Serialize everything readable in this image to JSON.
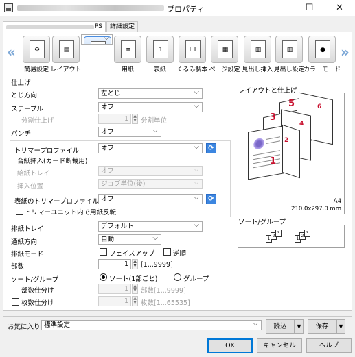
{
  "window": {
    "title": "プロパティ",
    "minimize": "—",
    "maximize": "☐",
    "close": "✕"
  },
  "tabs": [
    {
      "label": "PS"
    },
    {
      "label": "詳細設定"
    }
  ],
  "icon_bar": {
    "prev_arrow": "«",
    "next_arrow": "»",
    "items": [
      {
        "label": "簡易設定",
        "icon": "quick-setup-icon",
        "glyph": "⚙"
      },
      {
        "label": "レイアウト",
        "icon": "layout-icon",
        "glyph": "▤"
      },
      {
        "label": "仕上げ",
        "icon": "finishing-icon",
        "glyph": "☰",
        "selected": true
      },
      {
        "label": "用紙",
        "icon": "paper-icon",
        "glyph": "≡"
      },
      {
        "label": "表紙",
        "icon": "cover-icon",
        "glyph": "1"
      },
      {
        "label": "くるみ製本",
        "icon": "perfect-binding-icon",
        "glyph": "❐"
      },
      {
        "label": "ページ設定",
        "icon": "page-setting-icon",
        "glyph": "▦"
      },
      {
        "label": "見出し挿入",
        "icon": "tab-insert-icon",
        "glyph": "▥"
      },
      {
        "label": "見出し設定",
        "icon": "tab-setting-icon",
        "glyph": "▥"
      },
      {
        "label": "カラーモード",
        "icon": "color-mode-icon",
        "glyph": "●"
      }
    ]
  },
  "finishing": {
    "section_title": "仕上げ",
    "binding": {
      "label": "とじ方向",
      "value": "左とじ"
    },
    "staple": {
      "label": "ステープル",
      "value": "オフ"
    },
    "split": {
      "label": "分割仕上げ",
      "value": "1",
      "unit": "分割単位"
    },
    "punch": {
      "label": "パンチ",
      "value": "オフ"
    },
    "trimmer": {
      "label": "トリマープロファイル",
      "value": "オフ"
    },
    "interleave_title": "合紙挿入(カード断裁用)",
    "feed_tray": {
      "label": "給紙トレイ",
      "value": "オフ"
    },
    "insert_pos": {
      "label": "挿入位置",
      "value": "ジョブ単位(後)"
    },
    "cover_trimmer": {
      "label": "表紙のトリマープロファイル",
      "value": "オフ"
    },
    "reverse": {
      "label": "トリマーユニット内で用紙反転"
    },
    "output_tray": {
      "label": "排紙トレイ",
      "value": "デフォルト"
    },
    "feed_direction": {
      "label": "通紙方向",
      "value": "自動"
    },
    "output_mode": {
      "label": "排紙モード",
      "faceup": "フェイスアップ",
      "reverse_order": "逆順"
    },
    "copies": {
      "label": "部数",
      "value": "1",
      "range": "[1...9999]"
    },
    "sort_group": {
      "label": "ソート/グループ",
      "sort": "ソート(1部ごと)",
      "group": "グループ"
    },
    "copy_separate": {
      "label": "部数仕分け",
      "value": "1",
      "hint": "部数[1...9999]"
    },
    "sheet_separate": {
      "label": "枚数仕分け",
      "value": "1",
      "hint": "枚数[1...65535]"
    }
  },
  "preview": {
    "title": "レイアウトと仕上げ",
    "page_numbers": [
      "5",
      "6",
      "3",
      "4",
      "1",
      "2"
    ],
    "paper": "A4",
    "size": "210.0x297.0 mm",
    "sort_title": "ソート/グループ",
    "sort_pages": [
      "1",
      "2",
      "3",
      "1",
      "2",
      "3"
    ]
  },
  "favorites": {
    "label": "お気に入り",
    "value": "標準設定",
    "load": "読込",
    "save": "保存"
  },
  "buttons": {
    "ok": "OK",
    "cancel": "キャンセル",
    "help": "ヘルプ"
  }
}
